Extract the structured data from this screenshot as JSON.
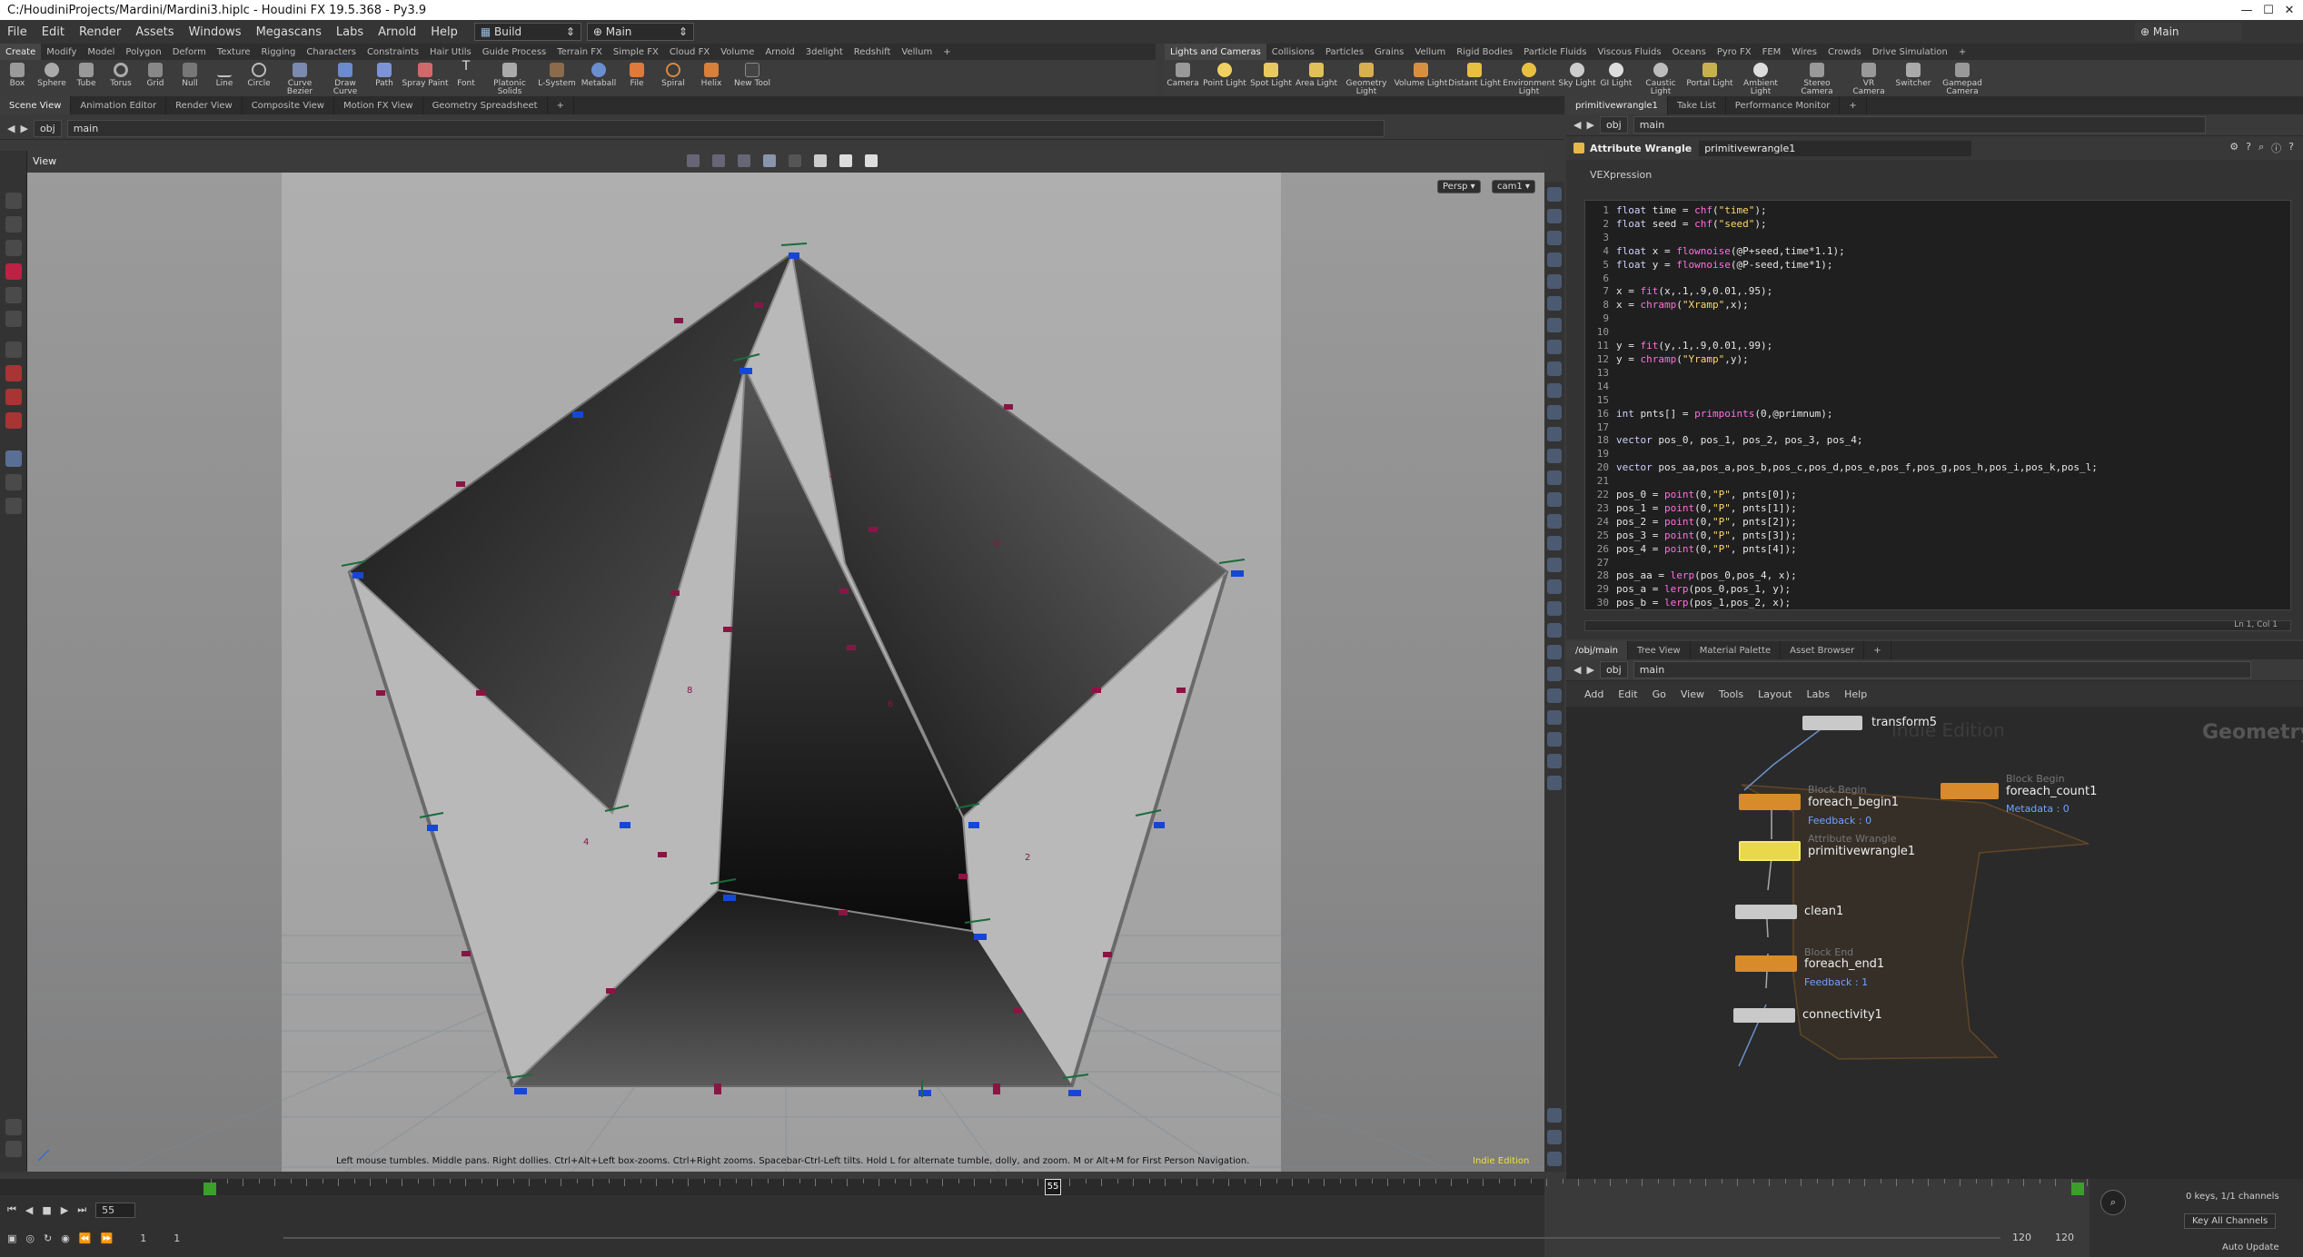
{
  "window": {
    "title": "C:/HoudiniProjects/Mardini/Mardini3.hiplc - Houdini FX 19.5.368 - Py3.9",
    "controls": [
      "—",
      "☐",
      "✕"
    ]
  },
  "menubar": {
    "items": [
      "File",
      "Edit",
      "Render",
      "Assets",
      "Windows",
      "Megascans",
      "Labs",
      "Arnold",
      "Help"
    ],
    "build_dropdown": "Build",
    "desktop_dropdown": "Main",
    "right_desktop": "Main"
  },
  "shelf_left": {
    "tabs": [
      "Create",
      "Modify",
      "Model",
      "Polygon",
      "Deform",
      "Texture",
      "Rigging",
      "Characters",
      "Constraints",
      "Hair Utils",
      "Guide Process",
      "Terrain FX",
      "Simple FX",
      "Cloud FX",
      "Volume",
      "Arnold",
      "3delight",
      "Redshift",
      "Vellum",
      "+"
    ],
    "tools": [
      "Box",
      "Sphere",
      "Tube",
      "Torus",
      "Grid",
      "Null",
      "Line",
      "Circle",
      "Curve Bezier",
      "Draw Curve",
      "Path",
      "Spray Paint",
      "Font",
      "Platonic Solids",
      "L-System",
      "Metaball",
      "File",
      "Spiral",
      "Helix",
      "New Tool"
    ]
  },
  "shelf_right": {
    "tabs": [
      "Lights and Cameras",
      "Collisions",
      "Particles",
      "Grains",
      "Vellum",
      "Rigid Bodies",
      "Particle Fluids",
      "Viscous Fluids",
      "Oceans",
      "Pyro FX",
      "FEM",
      "Wires",
      "Crowds",
      "Drive Simulation",
      "+"
    ],
    "tools": [
      "Camera",
      "Point Light",
      "Spot Light",
      "Area Light",
      "Geometry Light",
      "Volume Light",
      "Distant Light",
      "Environment Light",
      "Sky Light",
      "GI Light",
      "Caustic Light",
      "Portal Light",
      "Ambient Light",
      "Stereo Camera",
      "VR Camera",
      "Switcher",
      "Gamepad Camera"
    ]
  },
  "viewer": {
    "tabs": [
      "Scene View",
      "Animation Editor",
      "Render View",
      "Composite View",
      "Motion FX View",
      "Geometry Spreadsheet",
      "+"
    ],
    "path": [
      "obj",
      "main"
    ],
    "title": "View",
    "persp": "Persp ▾",
    "cam": "cam1 ▾",
    "status": "Left mouse tumbles. Middle pans. Right dollies. Ctrl+Alt+Left box-zooms. Ctrl+Right zooms. Spacebar-Ctrl-Left tilts. Hold L for alternate tumble, dolly, and zoom.     M or Alt+M for First Person Navigation.",
    "edition": "Indie Edition",
    "prim_numbers": [
      "1",
      "0",
      "8",
      "6",
      "4",
      "2"
    ]
  },
  "param_pane": {
    "tabs": [
      "primitivewrangle1",
      "Take List",
      "Performance Monitor",
      "+"
    ],
    "path": [
      "obj",
      "main"
    ],
    "node_type": "Attribute Wrangle",
    "node_name": "primitivewrangle1",
    "vex_label": "VEXpression",
    "cursor_pos": "Ln 1, Col 1"
  },
  "code_lines": [
    "float time = chf(\"time\");",
    "float seed = chf(\"seed\");",
    "",
    "float x = flownoise(@P+seed,time*1.1);",
    "float y = flownoise(@P-seed,time*1);",
    "",
    "x = fit(x,.1,.9,0.01,.95);",
    "x = chramp(\"Xramp\",x);",
    "",
    "",
    "y = fit(y,.1,.9,0.01,.99);",
    "y = chramp(\"Yramp\",y);",
    "",
    "",
    "",
    "int pnts[] = primpoints(0,@primnum);",
    "",
    "vector pos_0, pos_1, pos_2, pos_3, pos_4;",
    "",
    "vector pos_aa,pos_a,pos_b,pos_c,pos_d,pos_e,pos_f,pos_g,pos_h,pos_i,pos_k,pos_l;",
    "",
    "pos_0 = point(0,\"P\", pnts[0]);",
    "pos_1 = point(0,\"P\", pnts[1]);",
    "pos_2 = point(0,\"P\", pnts[2]);",
    "pos_3 = point(0,\"P\", pnts[3]);",
    "pos_4 = point(0,\"P\", pnts[4]);",
    "",
    "pos_aa = lerp(pos_0,pos_4, x);",
    "pos_a = lerp(pos_0,pos_1, y);",
    "pos_b = lerp(pos_1,pos_2, x);"
  ],
  "network_pane": {
    "tabs": [
      "/obj/main",
      "Tree View",
      "Material Palette",
      "Asset Browser",
      "+"
    ],
    "path": [
      "obj",
      "main"
    ],
    "menu": [
      "Add",
      "Edit",
      "Go",
      "View",
      "Tools",
      "Layout",
      "Labs",
      "Help"
    ],
    "watermark_left": "Indie Edition",
    "watermark_right": "Geometry",
    "nodes": {
      "transform": "transform5",
      "foreach_begin": {
        "sub": "Block Begin",
        "name": "foreach_begin1",
        "info": "Feedback : 0"
      },
      "foreach_count": {
        "sub": "Block Begin",
        "name": "foreach_count1",
        "info": "Metadata : 0"
      },
      "wrangle": {
        "sub": "Attribute Wrangle",
        "name": "primitivewrangle1"
      },
      "clean": {
        "name": "clean1"
      },
      "foreach_end": {
        "sub": "Block End",
        "name": "foreach_end1",
        "info": "Feedback : 1"
      },
      "connectivity": {
        "name": "connectivity1"
      }
    }
  },
  "timeline": {
    "current_frame": "55",
    "marker": "55",
    "start": "1",
    "start2": "1",
    "end": "120",
    "end2": "120",
    "keys": "0 keys, 1/1 channels",
    "key_all": "Key All Channels",
    "auto_update": "Auto Update"
  }
}
